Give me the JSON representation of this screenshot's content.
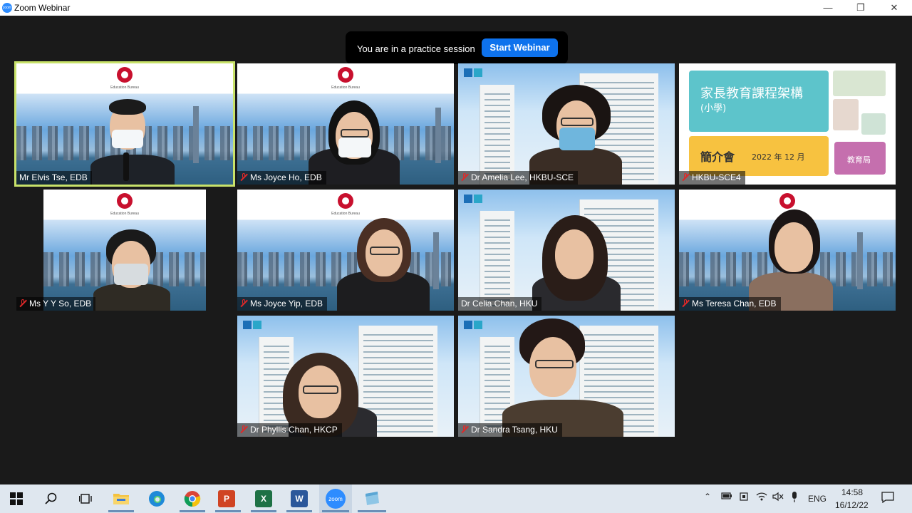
{
  "window": {
    "title": "Zoom Webinar",
    "app_icon_label": "zoom"
  },
  "practice": {
    "message": "You are in a practice session",
    "button": "Start Webinar"
  },
  "slide": {
    "title": "家長教育課程架構",
    "subtitle": "(小學)",
    "label": "簡介會",
    "date": "2022 年 12 月",
    "org": "教育局"
  },
  "edb_caption": "Education Bureau",
  "participants": [
    {
      "name": "Mr Elvis Tse, EDB",
      "muted": false
    },
    {
      "name": "Ms Joyce Ho, EDB",
      "muted": true
    },
    {
      "name": "Dr Amelia Lee, HKBU-SCE",
      "muted": true
    },
    {
      "name": "HKBU-SCE4",
      "muted": true
    },
    {
      "name": "Ms Y Y So, EDB",
      "muted": true
    },
    {
      "name": "Ms Joyce Yip, EDB",
      "muted": true
    },
    {
      "name": "Dr Celia Chan, HKU",
      "muted": false
    },
    {
      "name": "Ms Teresa Chan, EDB",
      "muted": true
    },
    {
      "name": "Dr Phyllis Chan, HKCP",
      "muted": true
    },
    {
      "name": "Dr Sandra Tsang, HKU",
      "muted": true
    }
  ],
  "taskbar": {
    "zoom_label": "zoom",
    "excel_label": "X",
    "ppt_label": "P",
    "word_label": "W",
    "lang": "ENG",
    "time": "14:58",
    "date": "16/12/22"
  }
}
